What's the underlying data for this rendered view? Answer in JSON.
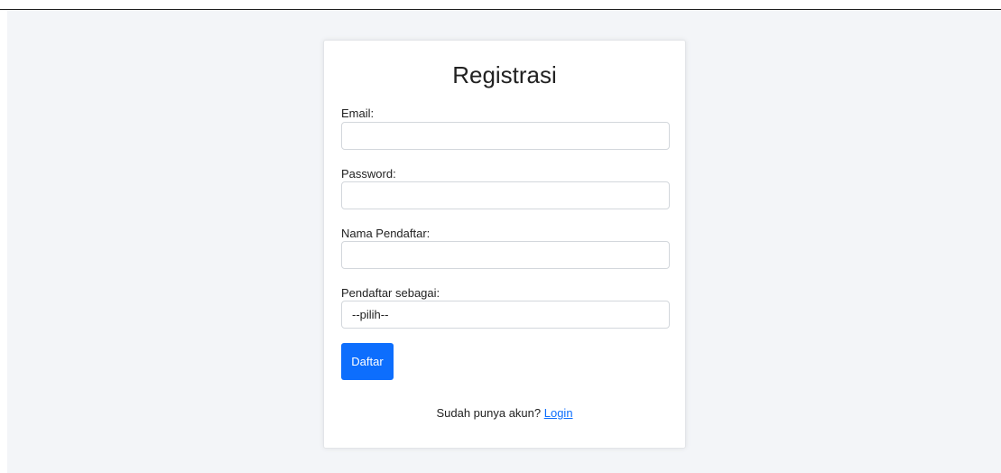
{
  "form": {
    "title": "Registrasi",
    "fields": [
      {
        "label": "Email:",
        "value": "",
        "placeholder": ""
      },
      {
        "label": "Password:",
        "value": "",
        "placeholder": ""
      },
      {
        "label": "Nama Pendaftar:",
        "value": "",
        "placeholder": ""
      }
    ],
    "role": {
      "label": "Pendaftar sebagai:",
      "selected": "--pilih--"
    },
    "submit_label": "Daftar"
  },
  "footer": {
    "prompt": "Sudah punya akun?",
    "link_label": "Login"
  },
  "colors": {
    "accent": "#0d6efd",
    "page_background": "#f3f5f8"
  }
}
